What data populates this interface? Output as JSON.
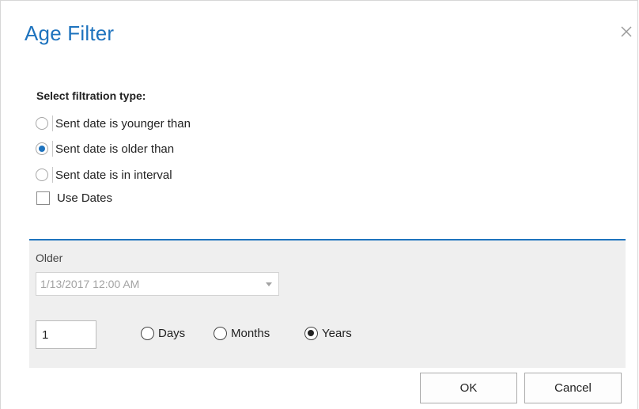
{
  "dialog": {
    "title": "Age Filter",
    "close_icon": "close-icon"
  },
  "filtration": {
    "label": "Select filtration type:",
    "options": [
      {
        "label": "Sent date is younger than",
        "checked": false
      },
      {
        "label": "Sent date is older than",
        "checked": true
      },
      {
        "label": "Sent date is in interval",
        "checked": false
      }
    ]
  },
  "use_dates": {
    "label": "Use Dates",
    "checked": false
  },
  "panel": {
    "older_label": "Older",
    "date_value": "1/13/2017 12:00 AM",
    "amount_value": "1",
    "units": [
      {
        "label": "Days",
        "checked": false
      },
      {
        "label": "Months",
        "checked": false
      },
      {
        "label": "Years",
        "checked": true
      }
    ]
  },
  "buttons": {
    "ok": "OK",
    "cancel": "Cancel"
  },
  "colors": {
    "accent": "#1e73be",
    "panel_bg": "#efefef"
  }
}
